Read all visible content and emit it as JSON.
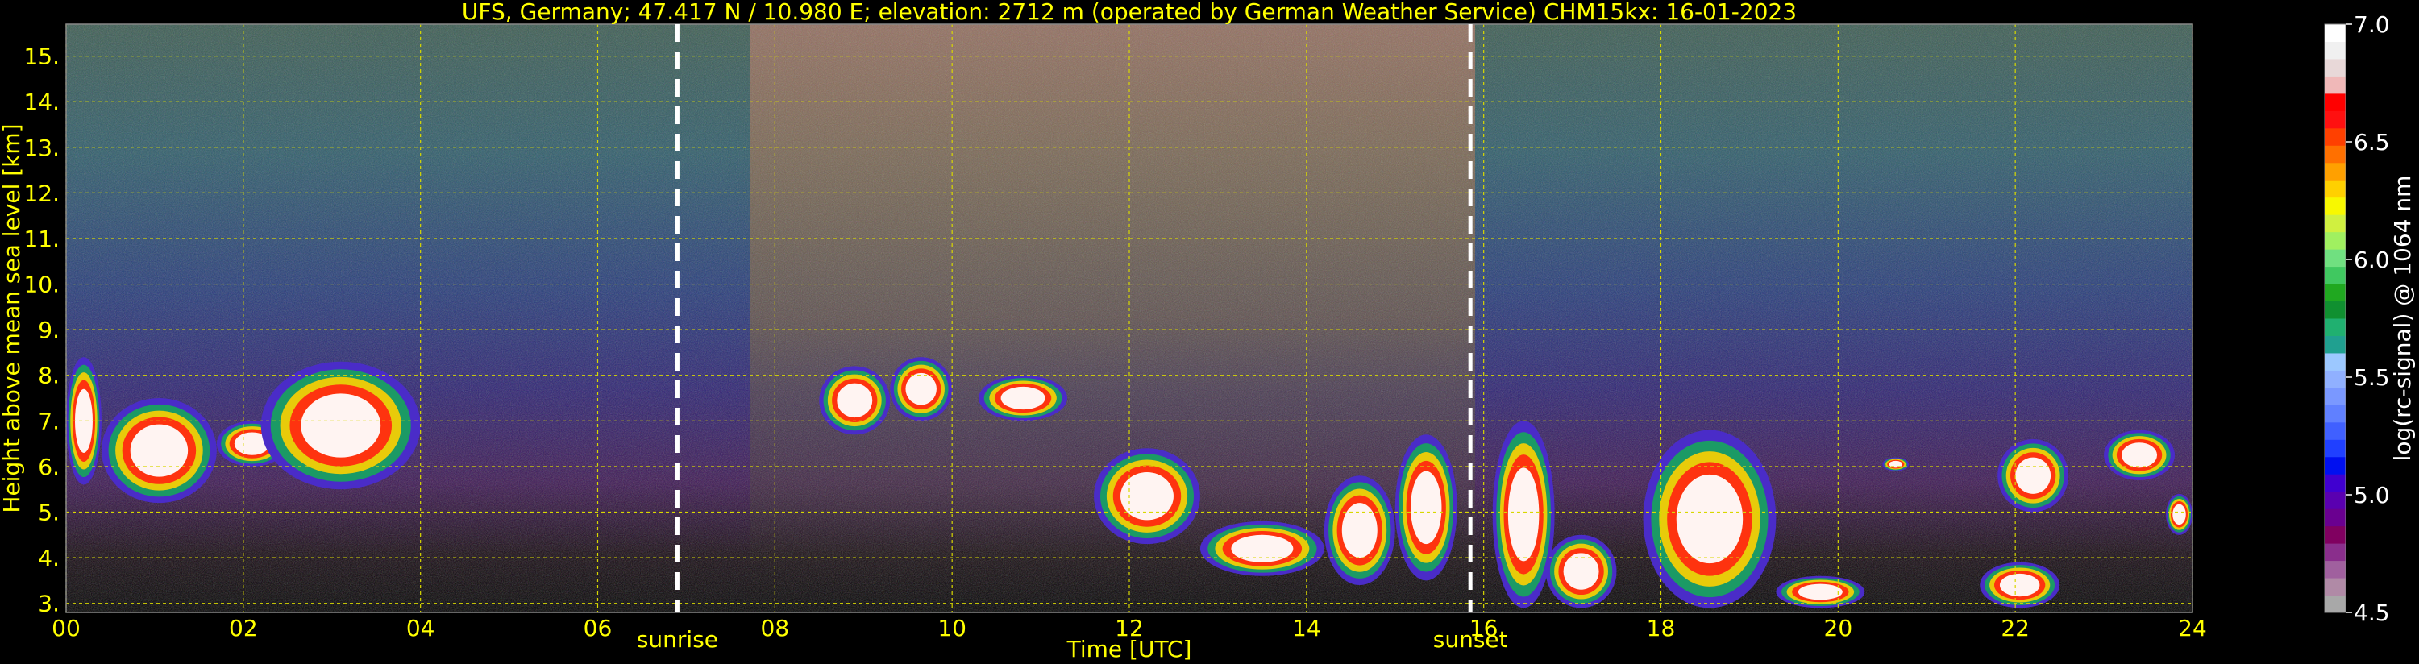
{
  "chart_data": {
    "type": "heatmap",
    "title": "UFS, Germany; 47.417 N / 10.980 E; elevation: 2712 m  (operated by German Weather Service)    CHM15kx: 16-01-2023",
    "xlabel": "Time [UTC]",
    "ylabel": "Height above mean sea level [km]",
    "xlim": [
      0,
      24
    ],
    "ylim": [
      2.8,
      15.7
    ],
    "x_ticks": [
      "00",
      "02",
      "04",
      "06",
      "08",
      "10",
      "12",
      "14",
      "16",
      "18",
      "20",
      "22",
      "24"
    ],
    "y_ticks": [
      "3.",
      "4.",
      "5.",
      "6.",
      "7.",
      "8.",
      "9.",
      "10.",
      "11.",
      "12.",
      "13.",
      "14.",
      "15."
    ],
    "grid": true,
    "annotations": [
      {
        "label": "sunrise",
        "x": 6.9
      },
      {
        "label": "sunset",
        "x": 15.85
      }
    ],
    "colorbar": {
      "label": "log(rc-signal) @ 1064 nm",
      "range": [
        4.5,
        7.0
      ],
      "ticks": [
        "4.5",
        "5.0",
        "5.5",
        "6.0",
        "6.5",
        "7.0"
      ],
      "colors": [
        "#a8a8a8",
        "#b08aa6",
        "#a0609e",
        "#8a2e8c",
        "#800060",
        "#6a0090",
        "#5a00b0",
        "#4000d0",
        "#0010f0",
        "#2040ff",
        "#4060ff",
        "#6080ff",
        "#7a98ff",
        "#90b0ff",
        "#9cc8ff",
        "#20a090",
        "#20b070",
        "#109030",
        "#20a820",
        "#40c860",
        "#70e080",
        "#a0f060",
        "#d0f040",
        "#f8f800",
        "#ffd000",
        "#ffa000",
        "#ff7000",
        "#ff4000",
        "#ff1010",
        "#ff0000",
        "#f0b8b8",
        "#e8d8d8",
        "#f0f0f0",
        "#ffffff"
      ]
    },
    "clouds": [
      {
        "start": 0.0,
        "end": 0.4,
        "base": 5.6,
        "top": 8.4
      },
      {
        "start": 0.4,
        "end": 1.7,
        "base": 5.2,
        "top": 7.5
      },
      {
        "start": 1.7,
        "end": 2.5,
        "base": 6.0,
        "top": 7.0
      },
      {
        "start": 2.2,
        "end": 4.0,
        "base": 5.5,
        "top": 8.3
      },
      {
        "start": 8.5,
        "end": 9.3,
        "base": 6.7,
        "top": 8.2
      },
      {
        "start": 9.3,
        "end": 10.0,
        "base": 7.0,
        "top": 8.4
      },
      {
        "start": 10.3,
        "end": 11.3,
        "base": 7.0,
        "top": 8.0
      },
      {
        "start": 11.6,
        "end": 12.8,
        "base": 4.3,
        "top": 6.4
      },
      {
        "start": 12.8,
        "end": 14.2,
        "base": 3.6,
        "top": 4.8
      },
      {
        "start": 14.2,
        "end": 15.0,
        "base": 3.4,
        "top": 5.8
      },
      {
        "start": 15.0,
        "end": 15.7,
        "base": 3.5,
        "top": 6.7
      },
      {
        "start": 16.1,
        "end": 16.8,
        "base": 2.9,
        "top": 7.0
      },
      {
        "start": 16.7,
        "end": 17.5,
        "base": 2.9,
        "top": 4.5
      },
      {
        "start": 17.8,
        "end": 19.3,
        "base": 2.9,
        "top": 6.8
      },
      {
        "start": 19.3,
        "end": 20.3,
        "base": 2.9,
        "top": 3.6
      },
      {
        "start": 20.5,
        "end": 20.8,
        "base": 5.9,
        "top": 6.2
      },
      {
        "start": 21.6,
        "end": 22.5,
        "base": 2.9,
        "top": 3.9
      },
      {
        "start": 21.8,
        "end": 22.6,
        "base": 5.0,
        "top": 6.6
      },
      {
        "start": 23.0,
        "end": 23.8,
        "base": 5.7,
        "top": 6.8
      },
      {
        "start": 23.7,
        "end": 24.0,
        "base": 4.5,
        "top": 5.4
      }
    ]
  }
}
